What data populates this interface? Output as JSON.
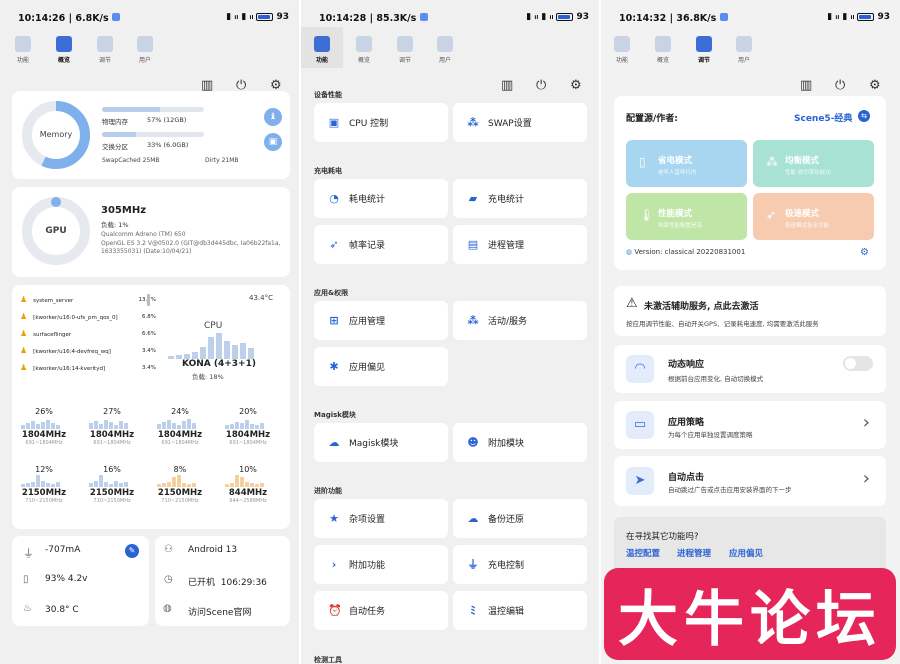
{
  "p1": {
    "status": {
      "time": "10:14:26",
      "speed": "6.8K/s",
      "battery": "93"
    },
    "tabs": [
      "功能",
      "概览",
      "调节",
      "用户"
    ],
    "memory": {
      "title": "Memory",
      "rows": [
        {
          "label": "物理内存",
          "value": "57% (12GB)",
          "pct": 0.57
        },
        {
          "label": "交换分区",
          "value": "33% (6.0GB)",
          "pct": 0.33
        }
      ],
      "swapcached_label": "SwapCached",
      "swapcached": "25MB",
      "dirty_label": "Dirty",
      "dirty": "21MB"
    },
    "gpu": {
      "title": "GPU",
      "freq": "305MHz",
      "load": "负载: 1%",
      "line1": "Qualcomm Adreno (TM) 650",
      "line2": "OpenGL ES 3.2 V@0502.0 (GIT@db3d445dbc, Ia06b22fa1a,",
      "line3": "1633355031) (Date:10/04/21)"
    },
    "cpu": {
      "temp": "43.4°C",
      "title": "CPU",
      "name": "KONA (4+3+1)",
      "load": "负载: 18%",
      "procs": [
        {
          "name": "system_server",
          "pct": "13.7%"
        },
        {
          "name": "[kworker/u16:0-ufs_pm_qos_0]",
          "pct": "6.8%"
        },
        {
          "name": "surfaceflinger",
          "pct": "6.6%"
        },
        {
          "name": "[kworker/u16:4-devfreq_wq]",
          "pct": "3.4%"
        },
        {
          "name": "[kworker/u16:14-kverityd]",
          "pct": "3.4%"
        }
      ],
      "cores": [
        {
          "pct": "26%",
          "mhz": "1804MHz",
          "range": "691~1804MHz"
        },
        {
          "pct": "27%",
          "mhz": "1804MHz",
          "range": "691~1804MHz"
        },
        {
          "pct": "24%",
          "mhz": "1804MHz",
          "range": "691~1804MHz"
        },
        {
          "pct": "20%",
          "mhz": "1804MHz",
          "range": "691~1804MHz"
        },
        {
          "pct": "12%",
          "mhz": "2150MHz",
          "range": "710~2150MHz"
        },
        {
          "pct": "16%",
          "mhz": "2150MHz",
          "range": "710~2150MHz"
        },
        {
          "pct": "8%",
          "mhz": "2150MHz",
          "range": "710~2150MHz"
        },
        {
          "pct": "10%",
          "mhz": "844MHz",
          "range": "844~2588MHz"
        }
      ]
    },
    "battery": {
      "current": "-707mA",
      "level": "93%  4.2v",
      "temp": "30.8° C"
    },
    "system": {
      "android": "Android 13",
      "uptime_label": "已开机",
      "uptime": "106:29:36",
      "site": "访问Scene官网"
    }
  },
  "p2": {
    "status": {
      "time": "10:14:28",
      "speed": "85.3K/s",
      "battery": "93"
    },
    "tabs": [
      "功能",
      "概览",
      "调节",
      "用户"
    ],
    "sections": [
      "设备性能",
      "充电耗电",
      "应用&权限",
      "Magisk模块",
      "进阶功能",
      "检测工具"
    ],
    "buttons": [
      "CPU 控制",
      "SWAP设置",
      "耗电统计",
      "充电统计",
      "帧率记录",
      "进程管理",
      "应用管理",
      "活动/服务",
      "应用偏见",
      "Magisk模块",
      "附加模块",
      "杂项设置",
      "备份还原",
      "附加功能",
      "充电控制",
      "自动任务",
      "温控编辑"
    ]
  },
  "p3": {
    "status": {
      "time": "10:14:32",
      "speed": "36.8K/s",
      "battery": "93"
    },
    "tabs": [
      "功能",
      "概览",
      "调节",
      "用户"
    ],
    "config": {
      "label": "配置源/作者:",
      "value": "Scene5-经典",
      "version": "Version: classical 20220831001"
    },
    "modes": [
      {
        "title": "省电模式",
        "sub": "老年人直呼行内",
        "color": "#a8d6f0"
      },
      {
        "title": "均衡模式",
        "sub": "性能 收功率功收功",
        "color": "#a8e2d4"
      },
      {
        "title": "性能模式",
        "sub": "咱家性能配置是高",
        "color": "#bfe6a6"
      },
      {
        "title": "极速模式",
        "sub": "极速模式各全功能",
        "color": "#f6cbb0"
      }
    ],
    "warn": {
      "title": "未激活辅助服务, 点此去激活",
      "desc": "按应用调节性能、自动开关GPS、记录耗电速度, 均需要激活此服务"
    },
    "features": [
      {
        "title": "动态响应",
        "desc": "根据前台应用变化, 自动切换模式"
      },
      {
        "title": "应用策略",
        "desc": "为每个应用单独设置调度策略"
      },
      {
        "title": "自动点击",
        "desc": "自动跳过广告或点击应用安装界面的下一步"
      }
    ],
    "more": {
      "q": "在寻找其它功能吗?",
      "links": [
        "温控配置",
        "进程管理",
        "应用偏见"
      ]
    },
    "watermark": "大牛论坛"
  }
}
